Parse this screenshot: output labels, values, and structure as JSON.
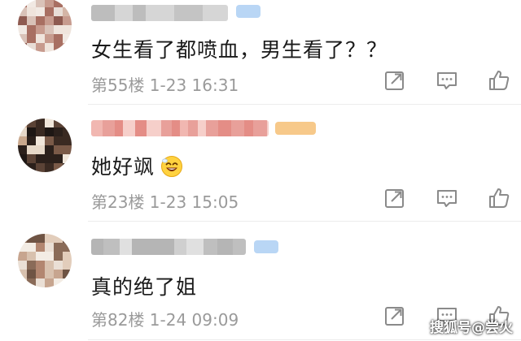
{
  "comments": [
    {
      "text": "女生看了都喷血，男生看了？？",
      "meta": "第55楼  1-23 16:31"
    },
    {
      "text": "她好飒",
      "emoji": "grinning-emoji",
      "meta": "第23楼  1-23 15:05"
    },
    {
      "text": "真的绝了姐",
      "meta": "第82楼  1-24 09:09"
    }
  ],
  "actions": [
    "share-icon",
    "comment-icon",
    "like-icon"
  ],
  "watermark": "搜狐号@尝火",
  "colors": {
    "meta_gray": "#9a9a9a",
    "icon_gray": "#8a8a8a",
    "badge_blue": "#b9d6f5",
    "badge_orange": "#f7c98a"
  }
}
